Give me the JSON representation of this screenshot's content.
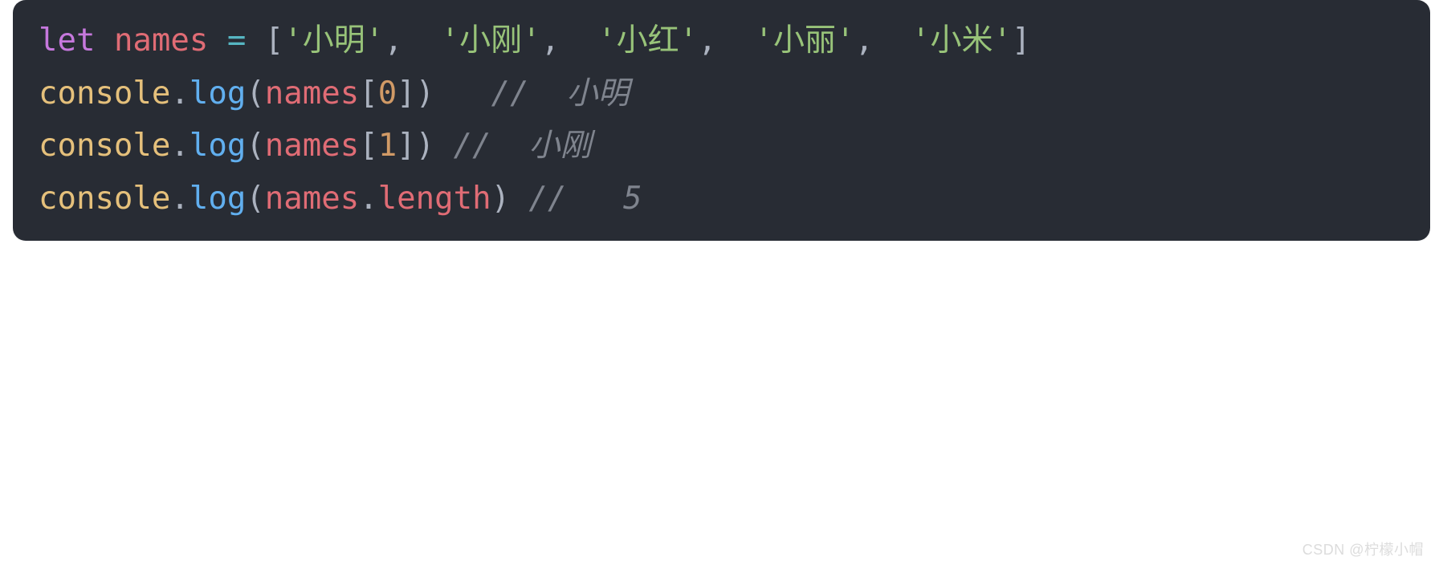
{
  "code": {
    "line1": {
      "keyword": "let",
      "varname": "names",
      "eq": "=",
      "lbracket": "[",
      "s1": "'小明'",
      "c1": ",",
      "s2": "'小刚'",
      "c2": ",",
      "s3": "'小红'",
      "c3": ",",
      "s4": "'小丽'",
      "c4": ",",
      "s5": "'小米'",
      "rbracket": "]"
    },
    "line2": {
      "obj": "console",
      "dot": ".",
      "method": "log",
      "lp": "(",
      "arg": "names",
      "lb": "[",
      "idx": "0",
      "rb": "]",
      "rp": ")",
      "comment": "//  小明"
    },
    "line3": {
      "obj": "console",
      "dot": ".",
      "method": "log",
      "lp": "(",
      "arg": "names",
      "lb": "[",
      "idx": "1",
      "rb": "]",
      "rp": ")",
      "comment": "//  小刚"
    },
    "line4": {
      "obj": "console",
      "dot": ".",
      "method": "log",
      "lp": "(",
      "arg": "names",
      "dot2": ".",
      "prop": "length",
      "rp": ")",
      "comment": "//   5"
    }
  },
  "watermark": "CSDN @柠檬小帽"
}
